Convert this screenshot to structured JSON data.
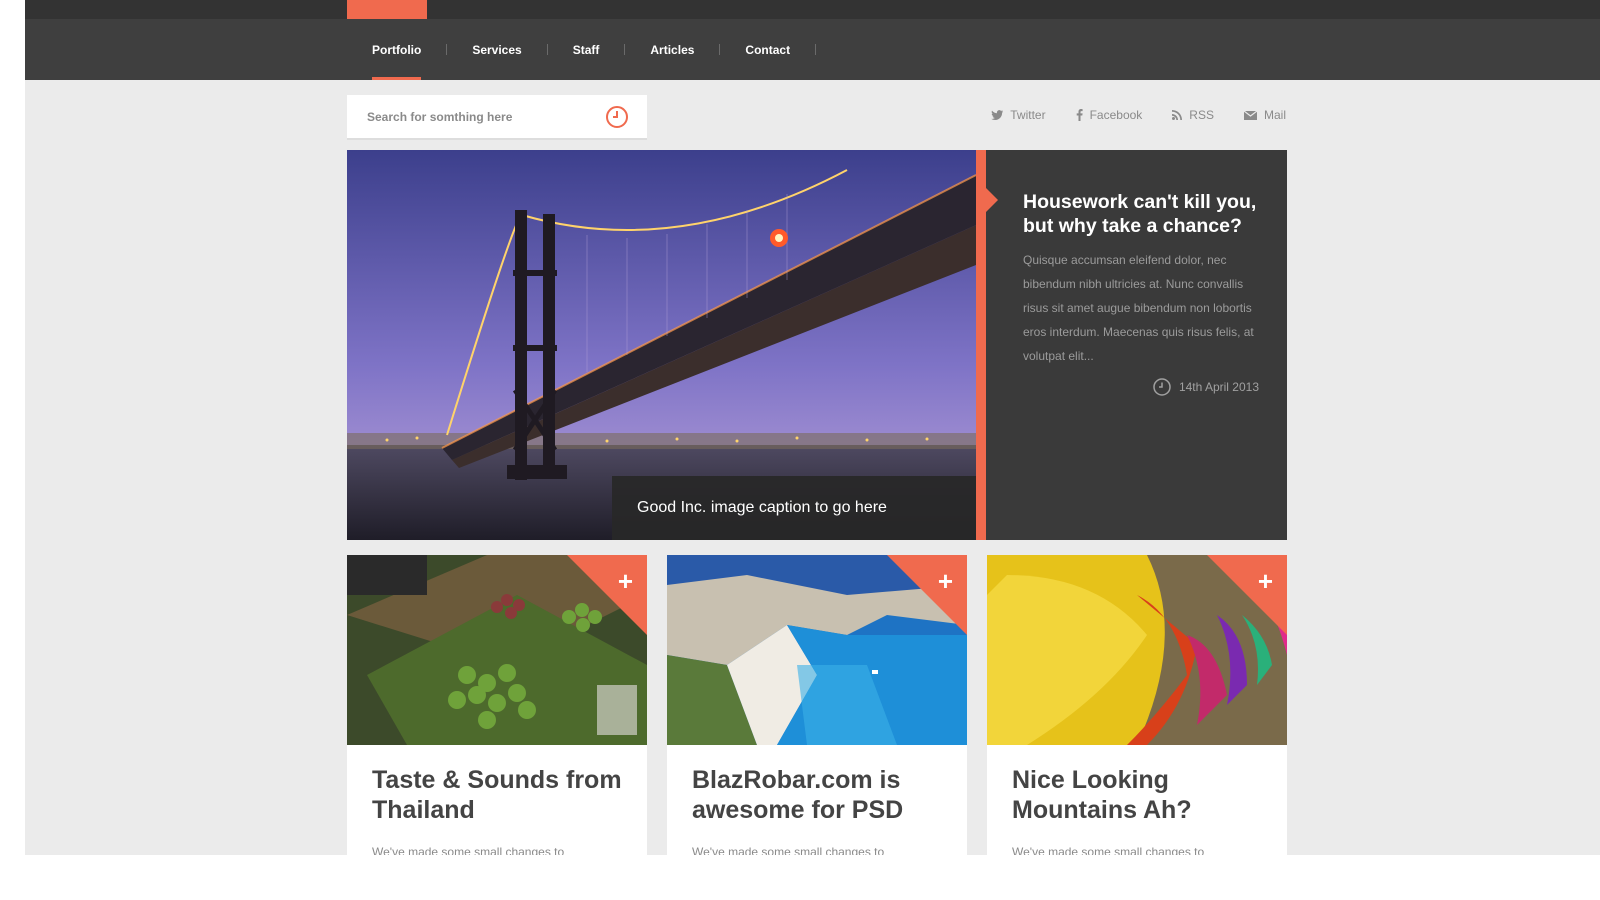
{
  "nav": {
    "items": [
      {
        "label": "Portfolio",
        "active": true
      },
      {
        "label": "Services",
        "active": false
      },
      {
        "label": "Staff",
        "active": false
      },
      {
        "label": "Articles",
        "active": false
      },
      {
        "label": "Contact",
        "active": false
      }
    ]
  },
  "search": {
    "placeholder": "Search for somthing here",
    "value": ""
  },
  "social": [
    {
      "label": "Twitter",
      "icon": "twitter-icon"
    },
    {
      "label": "Facebook",
      "icon": "facebook-icon"
    },
    {
      "label": "RSS",
      "icon": "rss-icon"
    },
    {
      "label": "Mail",
      "icon": "mail-icon"
    }
  ],
  "hero": {
    "caption": "Good Inc. image caption to go here",
    "title": "Housework can't kill you, but why take a chance?",
    "body": "Quisque accumsan eleifend dolor, nec bibendum nibh ultricies at. Nunc convallis risus sit amet augue bibendum non lobortis eros interdum. Maecenas quis risus felis, at volutpat elit...",
    "date": "14th April 2013"
  },
  "cards": [
    {
      "title": "Taste & Sounds from Thailand",
      "desc": "We've made some small changes to"
    },
    {
      "title": "BlazRobar.com is awesome for PSD",
      "desc": "We've made some small changes to"
    },
    {
      "title": "Nice Looking Mountains Ah?",
      "desc": "We've made some small changes to"
    }
  ],
  "colors": {
    "accent": "#f06a4e",
    "dark": "#3f3f3f",
    "background": "#ebebeb"
  }
}
